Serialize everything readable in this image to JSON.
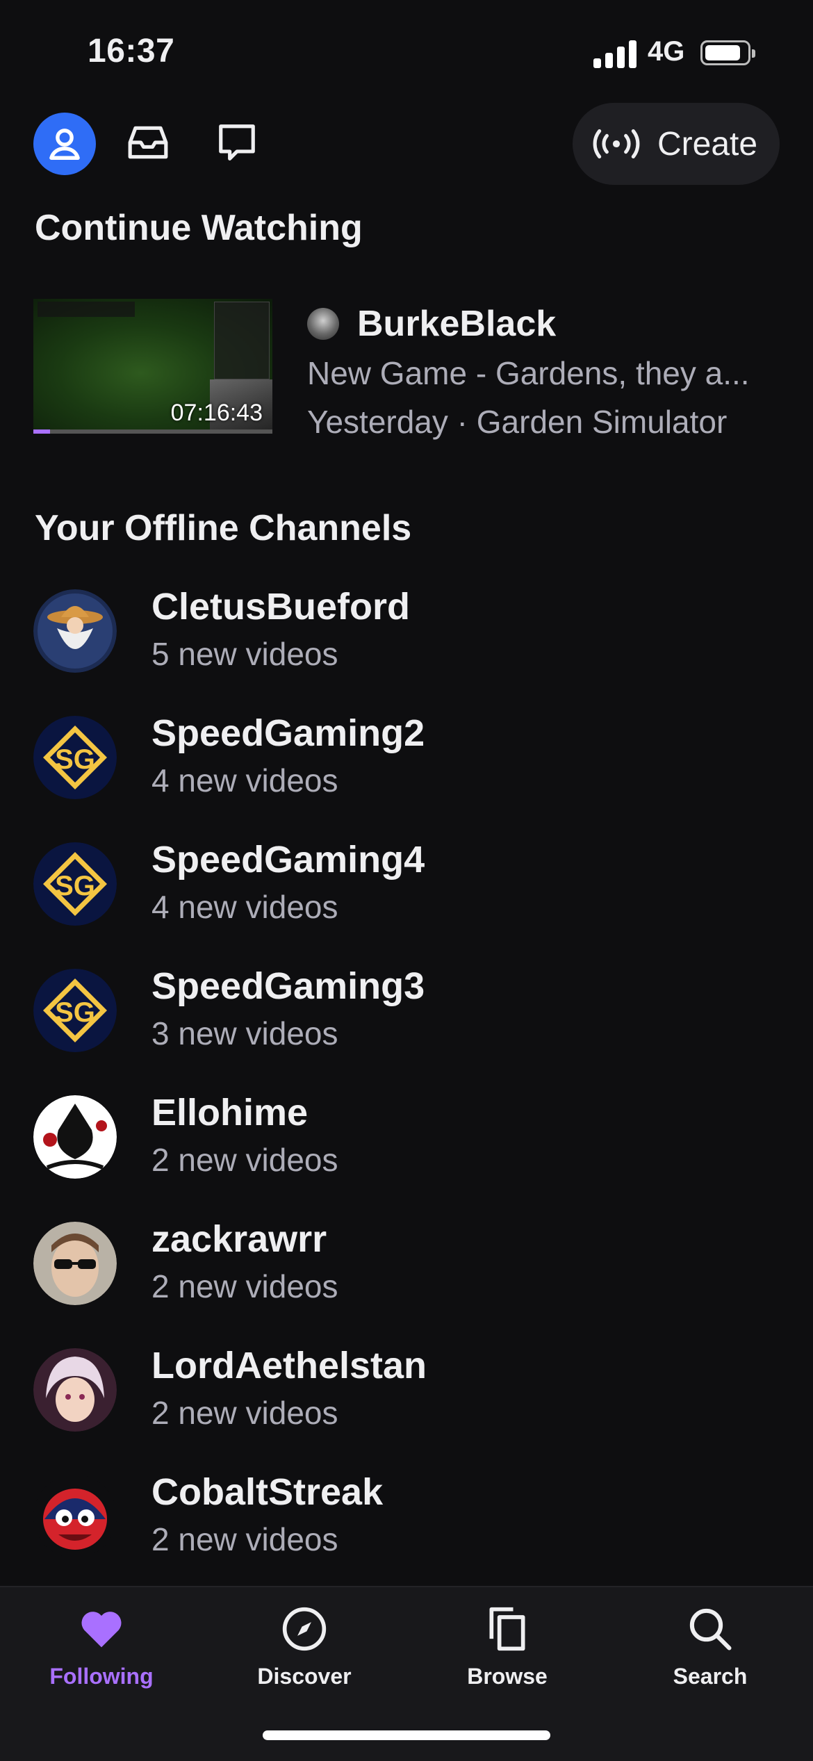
{
  "status_bar": {
    "time": "16:37",
    "network": "4G"
  },
  "top_nav": {
    "create_label": "Create"
  },
  "continue_watching": {
    "title": "Continue Watching",
    "item": {
      "duration": "07:16:43",
      "progress_fraction": 0.07,
      "channel": "BurkeBlack",
      "video_title": "New Game - Gardens, they a...",
      "meta": "Yesterday · Garden Simulator"
    }
  },
  "offline_channels": {
    "title": "Your Offline Channels",
    "items": [
      {
        "name": "CletusBueford",
        "subtitle": "5 new videos",
        "avatar_icon": "cowboy-wizard-avatar"
      },
      {
        "name": "SpeedGaming2",
        "subtitle": "4 new videos",
        "avatar_icon": "sg-logo-avatar"
      },
      {
        "name": "SpeedGaming4",
        "subtitle": "4 new videos",
        "avatar_icon": "sg-logo-avatar"
      },
      {
        "name": "SpeedGaming3",
        "subtitle": "3 new videos",
        "avatar_icon": "sg-logo-avatar"
      },
      {
        "name": "Ellohime",
        "subtitle": "2 new videos",
        "avatar_icon": "ellohime-avatar"
      },
      {
        "name": "zackrawrr",
        "subtitle": "2 new videos",
        "avatar_icon": "person-sunglasses-avatar"
      },
      {
        "name": "LordAethelstan",
        "subtitle": "2 new videos",
        "avatar_icon": "anime-character-avatar"
      },
      {
        "name": "CobaltStreak",
        "subtitle": "2 new videos",
        "avatar_icon": "red-creature-avatar"
      }
    ]
  },
  "bottom_nav": {
    "tabs": [
      {
        "label": "Following",
        "icon": "heart-icon",
        "active": true
      },
      {
        "label": "Discover",
        "icon": "compass-icon",
        "active": false
      },
      {
        "label": "Browse",
        "icon": "browse-icon",
        "active": false
      },
      {
        "label": "Search",
        "icon": "search-icon",
        "active": false
      }
    ]
  },
  "colors": {
    "accent": "#a970ff",
    "background": "#0e0e10",
    "profile_blue": "#2f6df6",
    "muted_text": "#adadb8"
  }
}
